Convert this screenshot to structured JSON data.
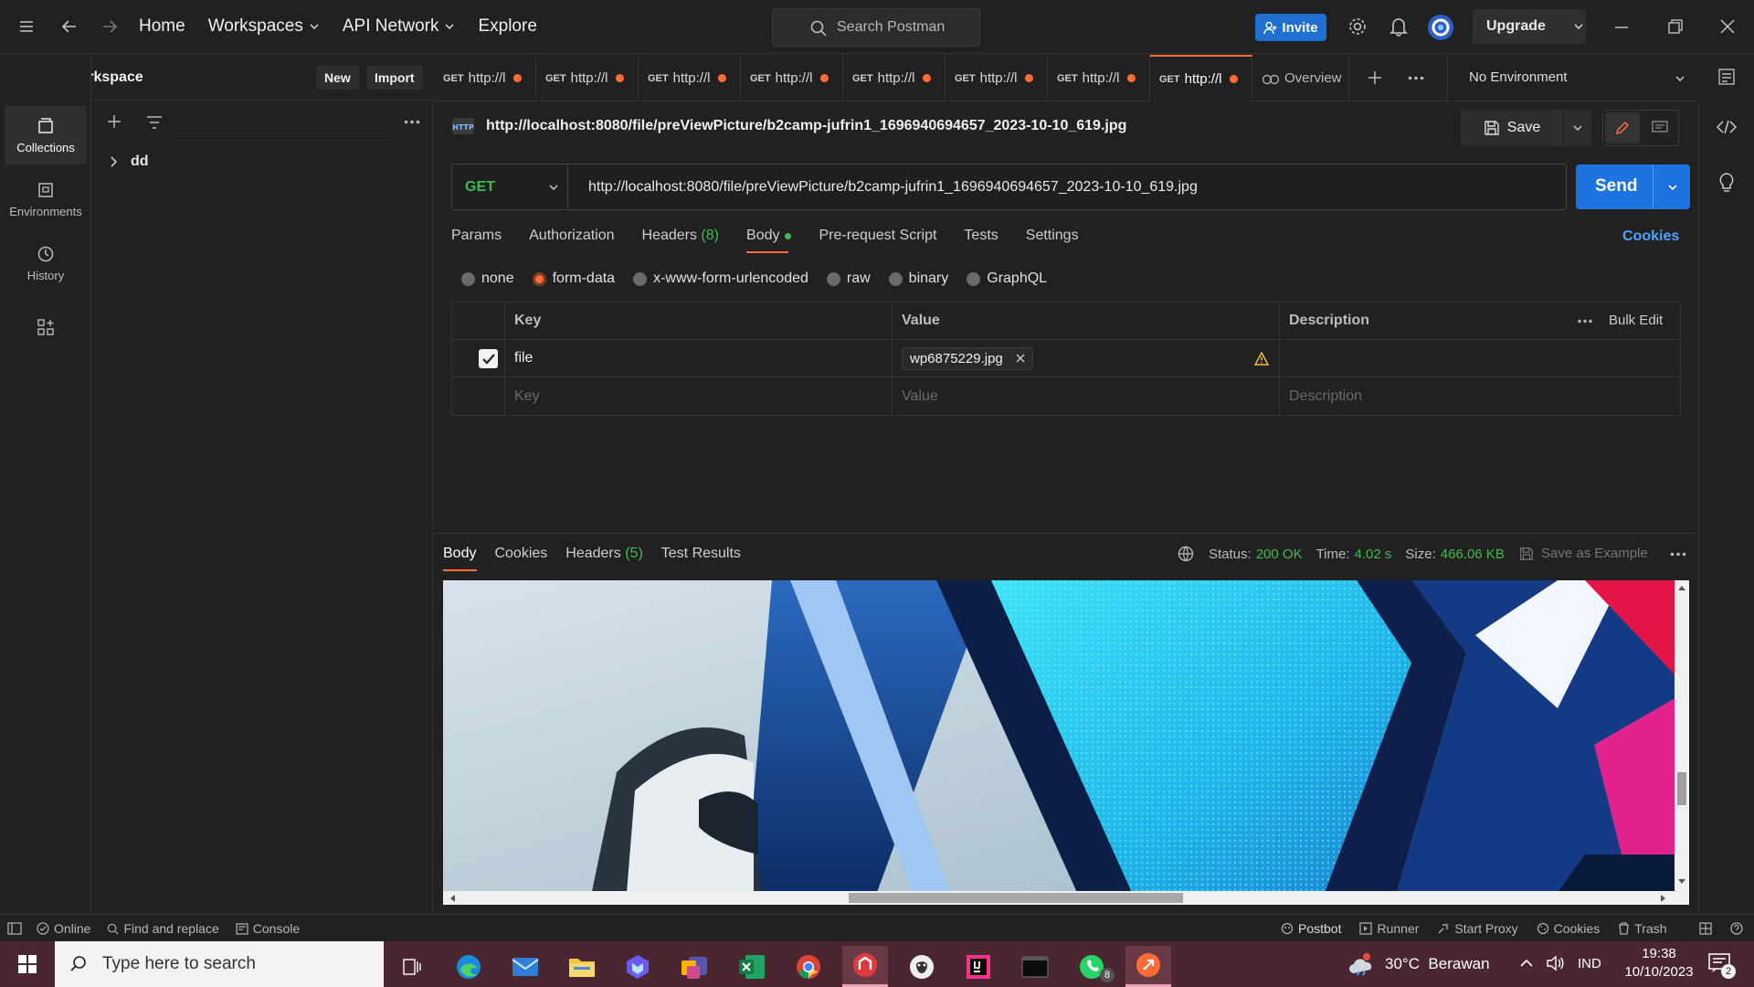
{
  "topbar": {
    "nav": [
      "Home",
      "Workspaces",
      "API Network",
      "Explore"
    ],
    "search_placeholder": "Search Postman",
    "invite_label": "Invite",
    "upgrade_label": "Upgrade"
  },
  "workspace": {
    "name": "My Workspace",
    "new_label": "New",
    "import_label": "Import"
  },
  "rail": [
    {
      "label": "Collections",
      "icon": "collections-icon",
      "active": true
    },
    {
      "label": "Environments",
      "icon": "environments-icon",
      "active": false
    },
    {
      "label": "History",
      "icon": "history-icon",
      "active": false
    },
    {
      "label": "",
      "icon": "apps-grid-icon",
      "active": false
    }
  ],
  "sidebar": {
    "collections": [
      {
        "name": "dd"
      }
    ]
  },
  "tabs": [
    {
      "method": "GET",
      "title": "http://l",
      "unsaved": true
    },
    {
      "method": "GET",
      "title": "http://l",
      "unsaved": true
    },
    {
      "method": "GET",
      "title": "http://l",
      "unsaved": true
    },
    {
      "method": "GET",
      "title": "http://l",
      "unsaved": true
    },
    {
      "method": "GET",
      "title": "http://l",
      "unsaved": true
    },
    {
      "method": "GET",
      "title": "http://l",
      "unsaved": true
    },
    {
      "method": "GET",
      "title": "http://l",
      "unsaved": true
    },
    {
      "method": "GET",
      "title": "http://l",
      "unsaved": true,
      "active": true
    }
  ],
  "overview_tab": "Overview",
  "environment": {
    "selected": "No Environment"
  },
  "request": {
    "name": "http://localhost:8080/file/preViewPicture/b2camp-jufrin1_1696940694657_2023-10-10_619.jpg",
    "save_label": "Save",
    "method": "GET",
    "url": "http://localhost:8080/file/preViewPicture/b2camp-jufrin1_1696940694657_2023-10-10_619.jpg",
    "send_label": "Send",
    "cookies_label": "Cookies",
    "subtabs": {
      "params": "Params",
      "authorization": "Authorization",
      "headers": "Headers",
      "headers_count": "(8)",
      "body": "Body",
      "prerequest": "Pre-request Script",
      "tests": "Tests",
      "settings": "Settings"
    },
    "body_types": [
      {
        "label": "none",
        "selected": false
      },
      {
        "label": "form-data",
        "selected": true
      },
      {
        "label": "x-www-form-urlencoded",
        "selected": false
      },
      {
        "label": "raw",
        "selected": false
      },
      {
        "label": "binary",
        "selected": false
      },
      {
        "label": "GraphQL",
        "selected": false
      }
    ],
    "table": {
      "headers": {
        "key": "Key",
        "value": "Value",
        "description": "Description"
      },
      "bulk_edit": "Bulk Edit",
      "rows": [
        {
          "checked": true,
          "key": "file",
          "value": "wp6875229.jpg",
          "description": ""
        }
      ],
      "placeholders": {
        "key": "Key",
        "value": "Value",
        "description": "Description"
      }
    }
  },
  "response": {
    "tabs": {
      "body": "Body",
      "cookies": "Cookies",
      "headers": "Headers",
      "headers_count": "(5)",
      "test_results": "Test Results"
    },
    "status_label": "Status:",
    "status_value": "200 OK",
    "time_label": "Time:",
    "time_value": "4.02 s",
    "size_label": "Size:",
    "size_value": "466.06 KB",
    "save_example": "Save as Example"
  },
  "statusbar": {
    "left": [
      "Online",
      "Find and replace",
      "Console"
    ],
    "right": [
      "Postbot",
      "Runner",
      "Start Proxy",
      "Cookies",
      "Trash"
    ]
  },
  "taskbar": {
    "search_placeholder": "Type here to search",
    "weather": "30°C  Berawan",
    "language": "IND",
    "time": "19:38",
    "date": "10/10/2023",
    "whatsapp_badge": "8",
    "notification_badge": "2"
  },
  "colors": {
    "accent": "#ff6c37",
    "primary_blue": "#1d73e0",
    "success_green": "#3fb950"
  }
}
